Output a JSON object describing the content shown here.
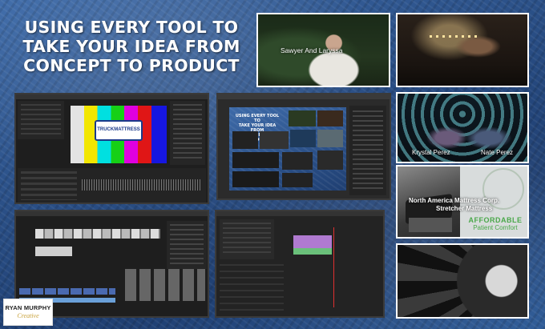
{
  "headline": {
    "line1": "USING EVERY TOOL TO",
    "line2": "TAKE YOUR IDEA FROM",
    "line3": "CONCEPT TO PRODUCT"
  },
  "videos": {
    "wedding_caption": "Sawyer And Laryssa",
    "speaker_left": "Krystal Perez",
    "speaker_right": "Nate Perez",
    "product_title_line1": "North America Mattress Corp.",
    "product_title_line2": "Stretcher Mattress",
    "product_tag_line1": "AFFORDABLE",
    "product_tag_line2": "Patient Comfort"
  },
  "editor": {
    "brand_card_text": "TRUCKMATTRESS"
  },
  "branding": {
    "name": "RYAN MURPHY",
    "subtitle": "Creative"
  },
  "colors": {
    "background": "#2a4f86",
    "headline_text": "#ffffff",
    "accent_green": "#5cb85c",
    "accent_gold": "#c9a23b"
  },
  "icons": [
    "camera-icon",
    "timeline-icon"
  ]
}
